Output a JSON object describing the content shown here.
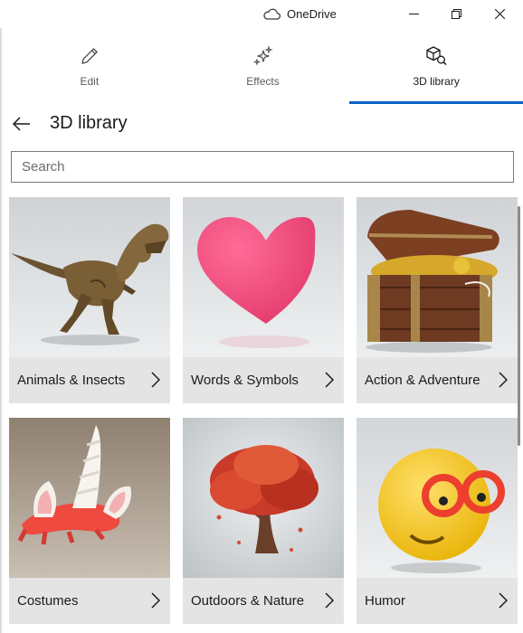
{
  "window": {
    "title": "OneDrive",
    "controls": [
      "minimize",
      "restore",
      "close"
    ]
  },
  "tabs": [
    {
      "label": "Edit",
      "icon": "pencil-icon",
      "active": false
    },
    {
      "label": "Effects",
      "icon": "sparkles-icon",
      "active": false
    },
    {
      "label": "3D library",
      "icon": "3d-library-icon",
      "active": true
    }
  ],
  "header": {
    "title": "3D library"
  },
  "search": {
    "placeholder": "Search",
    "value": ""
  },
  "categories": [
    {
      "label": "Animals & Insects"
    },
    {
      "label": "Words & Symbols"
    },
    {
      "label": "Action & Adventure"
    },
    {
      "label": "Costumes"
    },
    {
      "label": "Outdoors & Nature"
    },
    {
      "label": "Humor"
    }
  ],
  "colors": {
    "accent": "#0a64c4",
    "caption_bg": "#e4e4e4",
    "heart": "#f0457a",
    "emoji": "#f3c21a"
  }
}
